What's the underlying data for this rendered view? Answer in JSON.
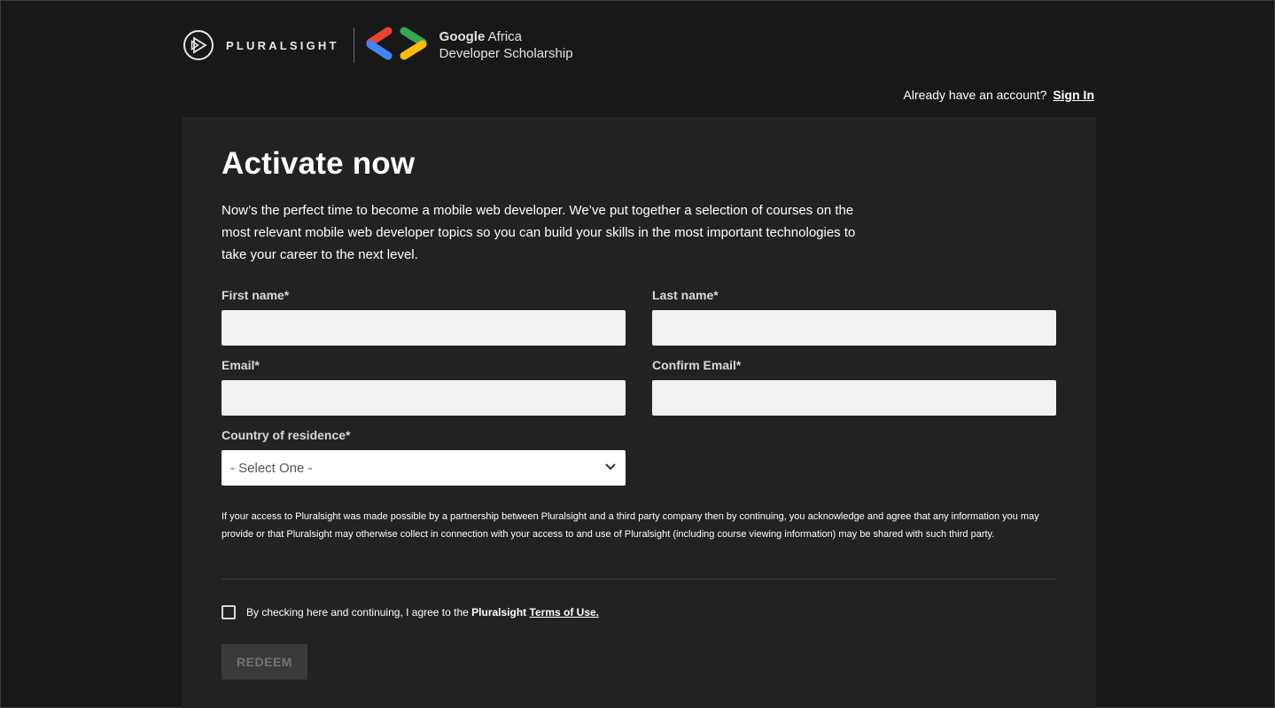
{
  "header": {
    "brand_wordmark": "PLURALSIGHT",
    "partner_line1_bold": "Google",
    "partner_line1_rest": " Africa",
    "partner_line2": "Developer Scholarship",
    "signin_prompt": "Already have an account?",
    "signin_link": "Sign In"
  },
  "form": {
    "title": "Activate now",
    "intro": "Now’s the perfect time to become a mobile web developer. We’ve put together a selection of courses on the most relevant mobile web developer topics so you can build your skills in the most important technologies to take your career to the next level.",
    "first_name_label": "First name*",
    "first_name_value": "",
    "last_name_label": "Last name*",
    "last_name_value": "",
    "email_label": "Email*",
    "email_value": "",
    "confirm_email_label": "Confirm Email*",
    "confirm_email_value": "",
    "country_label": "Country of residence*",
    "country_selected": "- Select One -",
    "disclaimer": "If your access to Pluralsight was made possible by a partnership between Pluralsight and a third party company then by continuing, you acknowledge and agree that any information you may provide or that Pluralsight may otherwise collect in connection with your access to and use of Pluralsight (including course viewing information) may be shared with such third party.",
    "terms_prefix": "By checking here and continuing, I agree to the ",
    "terms_brand": "Pluralsight",
    "terms_link": "Terms of Use.",
    "terms_checked": false,
    "redeem_label": "REDEEM"
  },
  "colors": {
    "background": "#181818",
    "card": "#222222",
    "google_blue": "#4285F4",
    "google_red": "#EA4335",
    "google_green": "#34A853",
    "google_yellow": "#FBBC05"
  },
  "icons": [
    "pluralsight-logo-icon",
    "google-dev-logo-icon",
    "chevron-down-icon",
    "checkbox-icon"
  ]
}
